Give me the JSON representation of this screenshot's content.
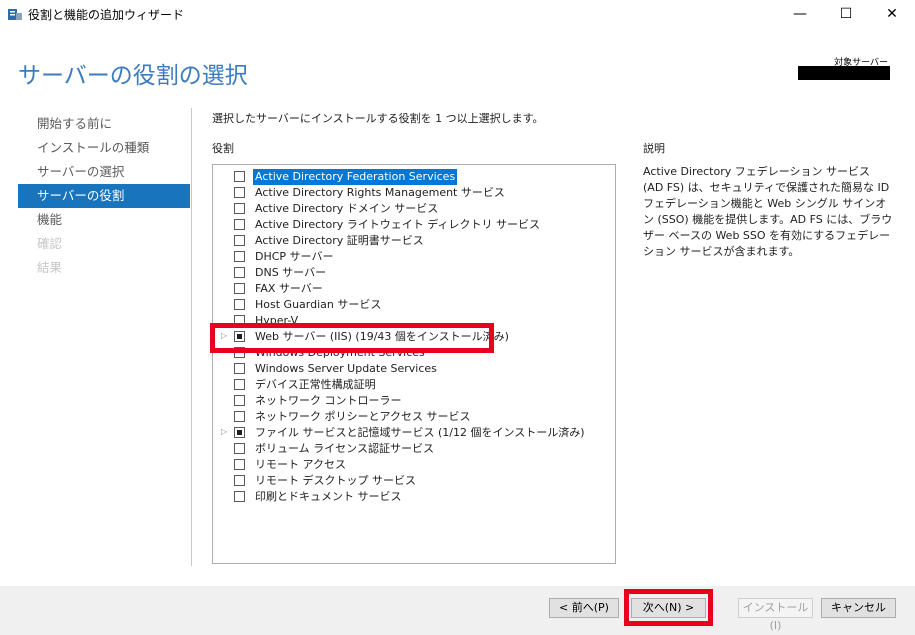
{
  "window": {
    "title": "役割と機能の追加ウィザード",
    "minimize": "—",
    "maximize": "☐",
    "close": "✕"
  },
  "header": {
    "page_title": "サーバーの役割の選択",
    "target_label": "対象サーバー"
  },
  "nav": {
    "items": [
      {
        "label": "開始する前に",
        "state": "normal"
      },
      {
        "label": "インストールの種類",
        "state": "normal"
      },
      {
        "label": "サーバーの選択",
        "state": "normal"
      },
      {
        "label": "サーバーの役割",
        "state": "active"
      },
      {
        "label": "機能",
        "state": "normal"
      },
      {
        "label": "確認",
        "state": "disabled"
      },
      {
        "label": "結果",
        "state": "disabled"
      }
    ]
  },
  "main": {
    "instruction": "選択したサーバーにインストールする役割を 1 つ以上選択します。",
    "roles_heading": "役割",
    "roles": [
      {
        "label": "Active Directory Federation Services",
        "checked": "none",
        "expandable": false,
        "selected": true
      },
      {
        "label": "Active Directory Rights Management サービス",
        "checked": "none",
        "expandable": false,
        "selected": false
      },
      {
        "label": "Active Directory ドメイン サービス",
        "checked": "none",
        "expandable": false,
        "selected": false
      },
      {
        "label": "Active Directory ライトウェイト ディレクトリ サービス",
        "checked": "none",
        "expandable": false,
        "selected": false
      },
      {
        "label": "Active Directory 証明書サービス",
        "checked": "none",
        "expandable": false,
        "selected": false
      },
      {
        "label": "DHCP サーバー",
        "checked": "none",
        "expandable": false,
        "selected": false
      },
      {
        "label": "DNS サーバー",
        "checked": "none",
        "expandable": false,
        "selected": false
      },
      {
        "label": "FAX サーバー",
        "checked": "none",
        "expandable": false,
        "selected": false
      },
      {
        "label": "Host Guardian サービス",
        "checked": "none",
        "expandable": false,
        "selected": false
      },
      {
        "label": "Hyper-V",
        "checked": "none",
        "expandable": false,
        "selected": false
      },
      {
        "label": "Web サーバー (IIS) (19/43 個をインストール済み)",
        "checked": "partial",
        "expandable": true,
        "selected": false
      },
      {
        "label": "Windows Deployment Services",
        "checked": "none",
        "expandable": false,
        "selected": false
      },
      {
        "label": "Windows Server Update Services",
        "checked": "none",
        "expandable": false,
        "selected": false
      },
      {
        "label": "デバイス正常性構成証明",
        "checked": "none",
        "expandable": false,
        "selected": false
      },
      {
        "label": "ネットワーク コントローラー",
        "checked": "none",
        "expandable": false,
        "selected": false
      },
      {
        "label": "ネットワーク ポリシーとアクセス サービス",
        "checked": "none",
        "expandable": false,
        "selected": false
      },
      {
        "label": "ファイル サービスと記憶域サービス (1/12 個をインストール済み)",
        "checked": "partial",
        "expandable": true,
        "selected": false
      },
      {
        "label": "ボリューム ライセンス認証サービス",
        "checked": "none",
        "expandable": false,
        "selected": false
      },
      {
        "label": "リモート アクセス",
        "checked": "none",
        "expandable": false,
        "selected": false
      },
      {
        "label": "リモート デスクトップ サービス",
        "checked": "none",
        "expandable": false,
        "selected": false
      },
      {
        "label": "印刷とドキュメント サービス",
        "checked": "none",
        "expandable": false,
        "selected": false
      }
    ],
    "expander_glyph": "▷",
    "description_heading": "説明",
    "description": "Active Directory フェデレーション サービス (AD FS) は、セキュリティで保護された簡易な ID フェデレーション機能と Web シングル サインオン (SSO) 機能を提供します。AD FS には、ブラウザー ベースの Web SSO を有効にするフェデレーション サービスが含まれます。"
  },
  "footer": {
    "prev_label": "< 前へ(P)",
    "next_label": "次へ(N) >",
    "install_label": "インストール(I)",
    "cancel_label": "キャンセル"
  },
  "colors": {
    "accent": "#1874bc",
    "title": "#3b7bbf",
    "highlight": "#e8001e",
    "selection": "#0078d7"
  }
}
